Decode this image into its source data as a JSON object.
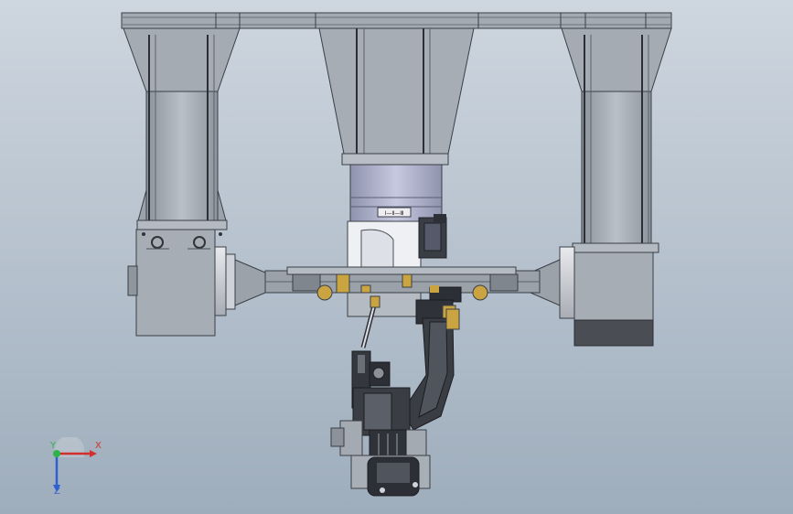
{
  "viewport": {
    "background_top": "#ced6df",
    "background_bottom": "#9eadbc"
  },
  "model": {
    "steel_color": "#9aa2ab",
    "motor_color": "#a8acc7",
    "brass_color": "#c9a441",
    "dark_color": "#2c2f36"
  },
  "motor_plate_text": "I—Ⅱ—Ⅲ",
  "triad": {
    "x_label": "X",
    "y_label": "Y",
    "z_label": "Z",
    "x_color": "#d0312d",
    "y_color": "#2fb24a",
    "z_color": "#2f5fd3"
  }
}
